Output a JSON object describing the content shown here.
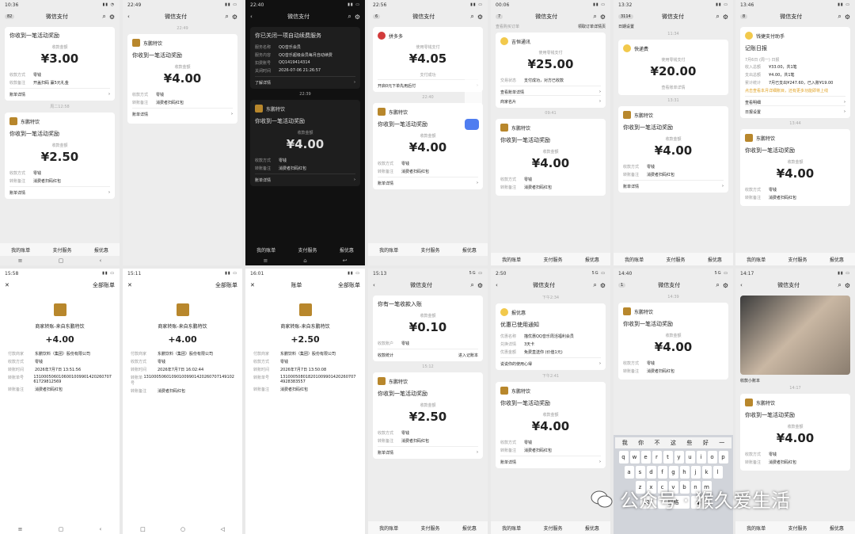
{
  "common": {
    "app_title": "微信支付",
    "amount_label": "收款金额",
    "detail_label": "账单详情",
    "activity_msg": "你收到一笔活动奖励",
    "merchant": "东鹏特饮",
    "method_key": "收款方式",
    "method_val": "零钱",
    "remark_key": "转账备注",
    "remark_val": "消费者扫码红包",
    "tabs": [
      "我的账单",
      "支付服务",
      "报优惠"
    ]
  },
  "p1": {
    "time": "10:36",
    "badge": "82",
    "merchant_top": "王老吉",
    "c1_amount": "¥3.00",
    "c1_remark_key": "收款备注",
    "c1_remark_val": "开盖扫码 赢5元礼金",
    "c2_amount": "¥2.50",
    "c2_remark_key": "转账备注",
    "divider_time": "周二12:58"
  },
  "p2": {
    "time": "22:49",
    "divider_time": "22:49",
    "amount": "¥4.00"
  },
  "p3": {
    "time": "22:40",
    "lines": [
      {
        "k": "",
        "v": "你已关闭一项自动续费服务"
      },
      {
        "k": "服务名称",
        "v": "QQ音乐会员"
      },
      {
        "k": "服务内容",
        "v": "QQ音乐超级会员每月自动续费"
      },
      {
        "k": "扣费账号",
        "v": "QQ1419414314"
      },
      {
        "k": "关闭时间",
        "v": "2026-07-06 21:26:57"
      }
    ],
    "learn_more": "了解详情",
    "divider_time": "22:39",
    "amount": "¥4.00"
  },
  "p4": {
    "time": "22:56",
    "badge": "6",
    "merchant": "拼多多",
    "use_label": "使用零钱支付",
    "amount1": "¥4.05",
    "fold": "支付成功",
    "promo": "开启0元下单先用后付",
    "divider_time": "22:40",
    "amount2": "¥4.00"
  },
  "p5": {
    "time": "00:06",
    "badge": "7",
    "top_link": "查看购买订单",
    "top_link2": "领取订单详情页",
    "merchant": "吉恒通讯",
    "use_label": "使用零钱支付",
    "amount1": "¥25.00",
    "deal_key": "交易状态",
    "deal_val": "支付成功，对方已收款",
    "view_detail": "查看账单详情",
    "biz_card": "商家名片",
    "divider_time": "09:41",
    "amount2": "¥4.00"
  },
  "p6": {
    "time": "13:32",
    "badge": "3114",
    "top": "日期设置",
    "t1": "11:34",
    "merchant": "快递费",
    "use_label": "使用零钱支付",
    "amount1": "¥20.00",
    "view": "查看账单详情",
    "divider_time": "13:31",
    "amount2": "¥4.00"
  },
  "p7": {
    "time": "13:46",
    "badge": "8",
    "top": "钱捷支付助手",
    "title": "记账日报",
    "sub": "7月6日 (周一) 日报",
    "rows": [
      {
        "k": "收入总额",
        "v": "¥33.00，共1笔"
      },
      {
        "k": "支出总额",
        "v": "¥4.00，共1笔"
      },
      {
        "k": "累计统计",
        "v": "7月已支出¥247.60，已入账¥19.00"
      }
    ],
    "hint": "点击查看本月详细账目，还有更多功能即将上线",
    "view": "查看明细",
    "set": "日报设置",
    "divider_time": "13:44",
    "amount": "¥4.00"
  },
  "p8": {
    "time": "15:58",
    "all": "全部账单",
    "name": "商家转账-来自东鹏特饮",
    "amount": "+4.00",
    "rows": [
      {
        "k": "付款商家",
        "v": "东鹏饮料（集团）股份有限公司"
      },
      {
        "k": "收款方式",
        "v": "零钱"
      },
      {
        "k": "转账时间",
        "v": "2026年7月7日 13:51:56"
      },
      {
        "k": "转账单号",
        "v": "1310005060106001009901420260707 61729812569"
      },
      {
        "k": "转账备注",
        "v": "消费者扫码红包"
      }
    ]
  },
  "p9": {
    "time": "15:11",
    "all": "全部账单",
    "name": "商家转账-来自东鹏特饮",
    "amount": "+4.00",
    "rows": [
      {
        "k": "付款商家",
        "v": "东鹏饮料（集团）股份有限公司"
      },
      {
        "k": "收款方式",
        "v": "零钱"
      },
      {
        "k": "转账时间",
        "v": "2026年7月7日 16:02:44"
      },
      {
        "k": "转账单号",
        "v": "131000506010901009901420260707149102"
      },
      {
        "k": "转账备注",
        "v": "消费者扫码红包"
      }
    ]
  },
  "p10": {
    "time": "16:01",
    "title": "账单",
    "all": "全部账单",
    "name": "商家转账-来自东鹏特饮",
    "amount": "+2.50",
    "rows": [
      {
        "k": "付款商家",
        "v": "东鹏饮料（集团）股份有限公司"
      },
      {
        "k": "收款方式",
        "v": "零钱"
      },
      {
        "k": "转账时间",
        "v": "2026年7月7日 13:50:08"
      },
      {
        "k": "转账单号",
        "v": "131000508018201009901420260707 4928383557"
      },
      {
        "k": "转账备注",
        "v": "消费者扫码红包"
      }
    ]
  },
  "p11": {
    "time": "15:13",
    "note": "你有一笔收款入账",
    "amount_label": "收款金额",
    "amount1": "¥0.10",
    "acct_k": "收款账户",
    "acct_v": "零钱",
    "stats": "收款统计",
    "stats_r": "进入记账本",
    "divider_time": "15:12",
    "amount2": "¥2.50"
  },
  "p12": {
    "time": "2:50",
    "divider_time": "下午2:34",
    "merchant": "报优惠",
    "note": "优惠已使用通知",
    "rows": [
      {
        "k": "优惠名称",
        "v": "描优惠QQ音乐周活福利会员"
      },
      {
        "k": "兑换详情",
        "v": "3天卡"
      },
      {
        "k": "优惠金额",
        "v": "免费直送你 (价值1元)"
      }
    ],
    "feedback": "说说你的使用心得",
    "divider_time2": "下午2:41",
    "amount": "¥4.00"
  },
  "p13": {
    "time": "14:40",
    "badge": "1",
    "divider_time": "14:39",
    "amount": "¥4.00",
    "cands": [
      "我",
      "你",
      "不",
      "这",
      "些",
      "好",
      "一"
    ],
    "k1": "qwertyuiop",
    "k2": "asdfghjkl",
    "k3": "zxcvbnm",
    "space": "空格",
    "k123": "123"
  },
  "p14": {
    "time": "14:17",
    "rows": [
      {
        "k": "付款方备注",
        "v": ""
      },
      {
        "k": "汇总",
        "v": ""
      },
      {
        "k": "备注",
        "v": ""
      }
    ],
    "recv": "收款小账本",
    "divider_time": "14:17",
    "amount": "¥4.00"
  },
  "watermark": "公众号 · 猴久爱生活"
}
